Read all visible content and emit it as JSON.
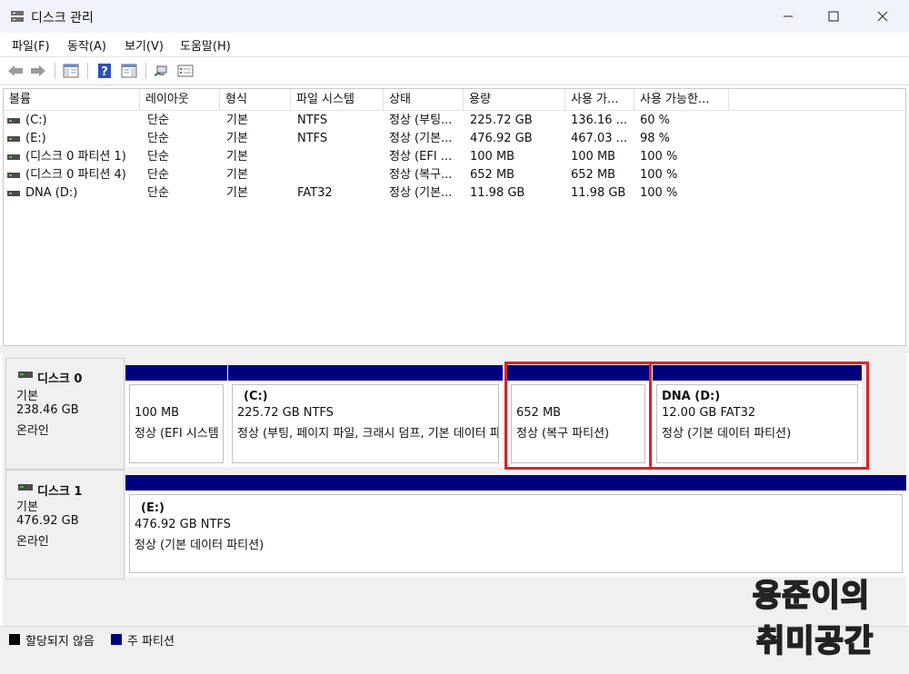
{
  "window": {
    "title": "디스크 관리"
  },
  "menu": [
    "파일(F)",
    "동작(A)",
    "보기(V)",
    "도움말(H)"
  ],
  "toolbar": [
    "back-icon",
    "forward-icon",
    "show-hide-console-tree-icon",
    "help-icon",
    "show-hide-action-pane-icon",
    "connect-icon",
    "properties-icon"
  ],
  "columns": [
    "볼륨",
    "레이아웃",
    "형식",
    "파일 시스템",
    "상태",
    "용량",
    "사용 가...",
    "사용 가능한..."
  ],
  "volumes": [
    [
      "(C:)",
      "단순",
      "기본",
      "NTFS",
      "정상 (부팅...",
      "225.72 GB",
      "136.16 ...",
      "60 %"
    ],
    [
      "(E:)",
      "단순",
      "기본",
      "NTFS",
      "정상 (기본...",
      "476.92 GB",
      "467.03 ...",
      "98 %"
    ],
    [
      "(디스크 0 파티션 1)",
      "단순",
      "기본",
      "",
      "정상 (EFI ...",
      "100 MB",
      "100 MB",
      "100 %"
    ],
    [
      "(디스크 0 파티션 4)",
      "단순",
      "기본",
      "",
      "정상 (복구...",
      "652 MB",
      "652 MB",
      "100 %"
    ],
    [
      "DNA (D:)",
      "단순",
      "기본",
      "FAT32",
      "정상 (기본...",
      "11.98 GB",
      "11.98 GB",
      "100 %"
    ]
  ],
  "disks": [
    {
      "name": "디스크 0",
      "type": "기본",
      "size": "238.46 GB",
      "status": "온라인",
      "partitions": [
        {
          "title": "",
          "line1": "100 MB",
          "line2": "정상 (EFI 시스템 파티션)"
        },
        {
          "title": "(C:)",
          "line1": "225.72 GB NTFS",
          "line2": "정상 (부팅, 페이지 파일, 크래시 덤프, 기본 데이터 파티션)"
        },
        {
          "title": "",
          "line1": "652 MB",
          "line2": "정상 (복구 파티션)"
        },
        {
          "title": "DNA   (D:)",
          "line1": "12.00 GB FAT32",
          "line2": "정상 (기본 데이터 파티션)"
        }
      ]
    },
    {
      "name": "디스크 1",
      "type": "기본",
      "size": "476.92 GB",
      "status": "온라인",
      "partitions": [
        {
          "title": "(E:)",
          "line1": "476.92 GB NTFS",
          "line2": "정상 (기본 데이터 파티션)"
        }
      ]
    }
  ],
  "legend": {
    "unallocated": "할당되지 않음",
    "primary": "주 파티션"
  },
  "colors": {
    "primary_bar": "#00007e",
    "unallocated": "#000000",
    "highlight": "#e0202a"
  },
  "watermark": {
    "line1": "용준이의",
    "line2": "취미공간"
  }
}
